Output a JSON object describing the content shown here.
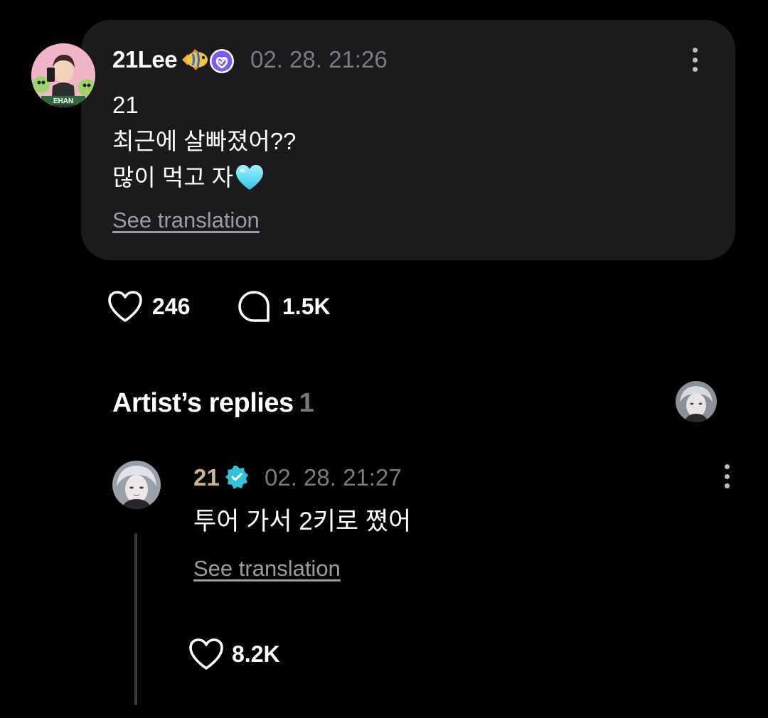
{
  "post": {
    "author": "21Lee",
    "timestamp": "02. 28. 21:26",
    "lines": [
      "21",
      "최근에 살빠졌어??",
      "많이 먹고 자"
    ],
    "see_translation": "See translation",
    "likes": "246",
    "comments": "1.5K",
    "emoji_icons": [
      "tropical-fish-emoji",
      "light-blue-heart-emoji"
    ]
  },
  "replies": {
    "title": "Artist’s replies",
    "count": "1",
    "items": [
      {
        "author": "21",
        "timestamp": "02. 28. 21:27",
        "text": "투어 가서 2키로 쪘어",
        "see_translation": "See translation",
        "likes": "8.2K"
      }
    ]
  },
  "icons": {
    "verified_fan": "purple-verified-badge-icon",
    "verified_artist": "teal-verified-badge-icon",
    "more": "more-vertical-icon",
    "like": "heart-outline-icon",
    "comment": "speech-bubble-icon"
  },
  "colors": {
    "background": "#000000",
    "card": "#1b1b1d",
    "muted_text": "#7a7a80",
    "link_text": "#9b9ba2",
    "artist_name": "#c9b793",
    "fan_badge": "#7b5cf0",
    "artist_badge": "#2fc2d8"
  }
}
